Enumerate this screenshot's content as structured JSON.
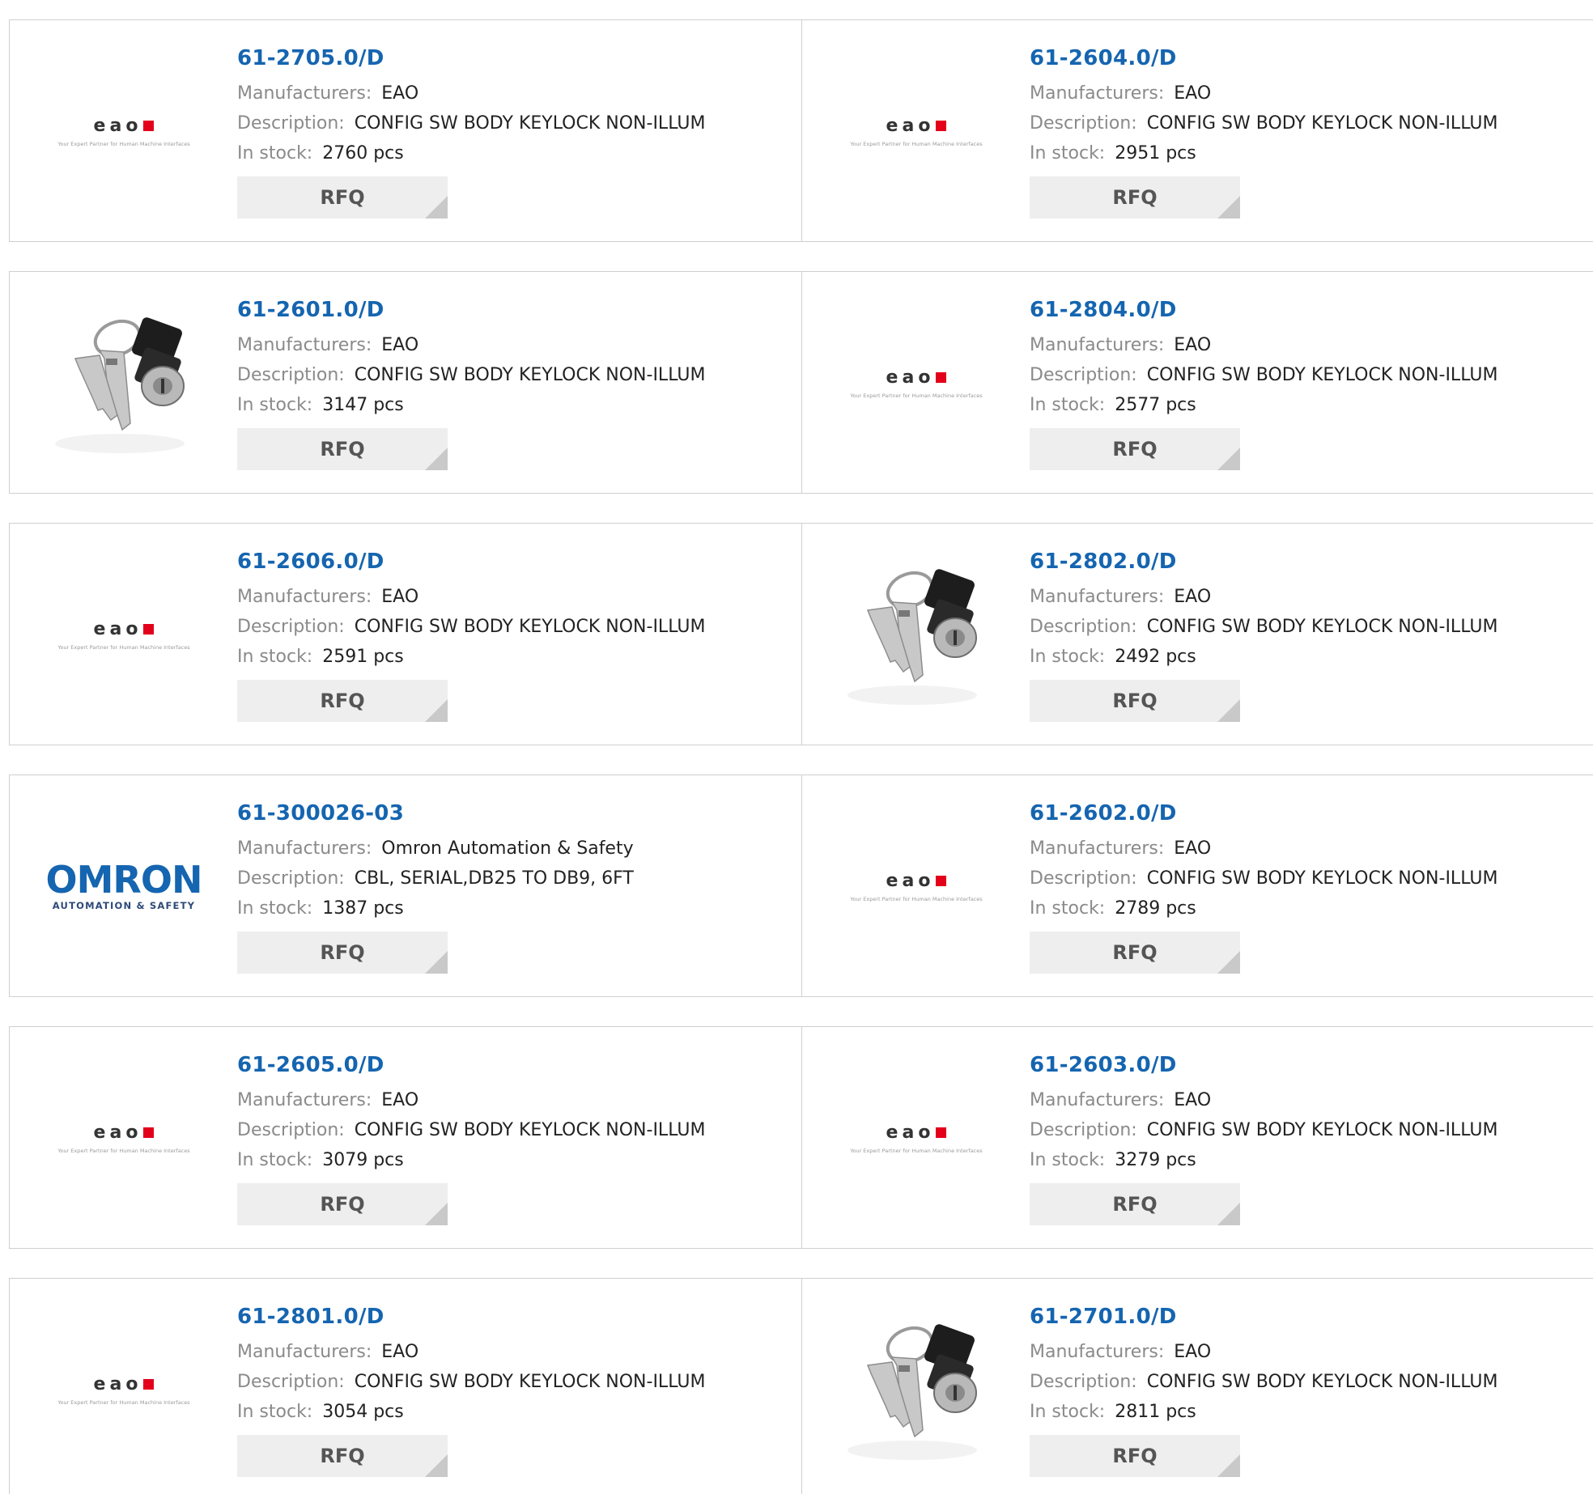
{
  "labels": {
    "manufacturer": "Manufacturers:",
    "description": "Description:",
    "stock": "In stock:",
    "rfq": "RFQ"
  },
  "logos": {
    "eao_word": "eao",
    "eao_tagline": "Your Expert Partner for Human Machine Interfaces",
    "omron_word": "OMRON",
    "omron_tagline": "AUTOMATION & SAFETY"
  },
  "colors": {
    "link": "#1565b0",
    "eao_red": "#e3001b"
  },
  "products": [
    {
      "part": "61-2705.0/D",
      "manufacturer": "EAO",
      "description": "CONFIG SW BODY KEYLOCK NON-ILLUM",
      "stock": "2760 pcs",
      "image": "eao-logo"
    },
    {
      "part": "61-2604.0/D",
      "manufacturer": "EAO",
      "description": "CONFIG SW BODY KEYLOCK NON-ILLUM",
      "stock": "2951 pcs",
      "image": "eao-logo"
    },
    {
      "part": "61-2601.0/D",
      "manufacturer": "EAO",
      "description": "CONFIG SW BODY KEYLOCK NON-ILLUM",
      "stock": "3147 pcs",
      "image": "keylock-photo"
    },
    {
      "part": "61-2804.0/D",
      "manufacturer": "EAO",
      "description": "CONFIG SW BODY KEYLOCK NON-ILLUM",
      "stock": "2577 pcs",
      "image": "eao-logo"
    },
    {
      "part": "61-2606.0/D",
      "manufacturer": "EAO",
      "description": "CONFIG SW BODY KEYLOCK NON-ILLUM",
      "stock": "2591 pcs",
      "image": "eao-logo"
    },
    {
      "part": "61-2802.0/D",
      "manufacturer": "EAO",
      "description": "CONFIG SW BODY KEYLOCK NON-ILLUM",
      "stock": "2492 pcs",
      "image": "keylock-photo"
    },
    {
      "part": "61-300026-03",
      "manufacturer": "Omron Automation & Safety",
      "description": "CBL, SERIAL,DB25 TO DB9, 6FT",
      "stock": "1387 pcs",
      "image": "omron-logo"
    },
    {
      "part": "61-2602.0/D",
      "manufacturer": "EAO",
      "description": "CONFIG SW BODY KEYLOCK NON-ILLUM",
      "stock": "2789 pcs",
      "image": "eao-logo"
    },
    {
      "part": "61-2605.0/D",
      "manufacturer": "EAO",
      "description": "CONFIG SW BODY KEYLOCK NON-ILLUM",
      "stock": "3079 pcs",
      "image": "eao-logo"
    },
    {
      "part": "61-2603.0/D",
      "manufacturer": "EAO",
      "description": "CONFIG SW BODY KEYLOCK NON-ILLUM",
      "stock": "3279 pcs",
      "image": "eao-logo"
    },
    {
      "part": "61-2801.0/D",
      "manufacturer": "EAO",
      "description": "CONFIG SW BODY KEYLOCK NON-ILLUM",
      "stock": "3054 pcs",
      "image": "eao-logo"
    },
    {
      "part": "61-2701.0/D",
      "manufacturer": "EAO",
      "description": "CONFIG SW BODY KEYLOCK NON-ILLUM",
      "stock": "2811 pcs",
      "image": "keylock-photo"
    }
  ]
}
